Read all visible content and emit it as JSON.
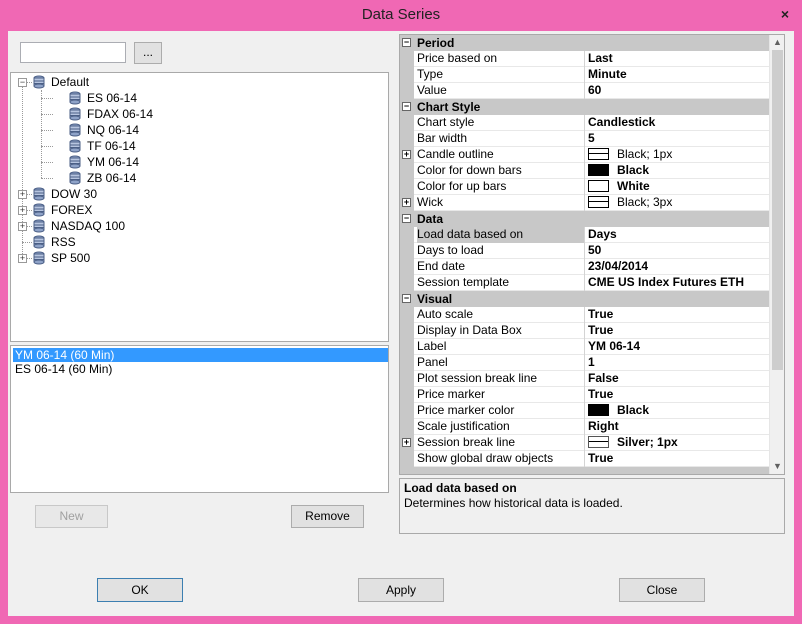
{
  "window": {
    "title": "Data Series",
    "close_glyph": "×"
  },
  "search": {
    "value": "",
    "browse_label": "..."
  },
  "tree": {
    "items": [
      {
        "label": "Default",
        "expanded": true,
        "level": 0
      },
      {
        "label": "ES 06-14",
        "level": 1
      },
      {
        "label": "FDAX 06-14",
        "level": 1
      },
      {
        "label": "NQ 06-14",
        "level": 1
      },
      {
        "label": "TF 06-14",
        "level": 1
      },
      {
        "label": "YM 06-14",
        "level": 1
      },
      {
        "label": "ZB 06-14",
        "level": 1
      },
      {
        "label": "DOW 30",
        "expanded": false,
        "level": 0
      },
      {
        "label": "FOREX",
        "expanded": false,
        "level": 0
      },
      {
        "label": "NASDAQ 100",
        "expanded": false,
        "level": 0
      },
      {
        "label": "RSS",
        "level": 0
      },
      {
        "label": "SP 500",
        "expanded": false,
        "level": 0
      }
    ]
  },
  "series_list": {
    "items": [
      {
        "label": "YM 06-14 (60 Min)",
        "selected": true
      },
      {
        "label": "ES 06-14 (60 Min)",
        "selected": false
      }
    ]
  },
  "buttons": {
    "new": "New",
    "remove": "Remove",
    "ok": "OK",
    "apply": "Apply",
    "close": "Close"
  },
  "grid": {
    "categories": [
      {
        "label": "Period",
        "props": [
          {
            "name": "Price based on",
            "value": "Last"
          },
          {
            "name": "Type",
            "value": "Minute"
          },
          {
            "name": "Value",
            "value": "60"
          }
        ]
      },
      {
        "label": "Chart Style",
        "props": [
          {
            "name": "Chart style",
            "value": "Candlestick"
          },
          {
            "name": "Bar width",
            "value": "5"
          },
          {
            "name": "Candle outline",
            "value": "Black; 1px",
            "swatch": "line",
            "light": true,
            "expandable": true
          },
          {
            "name": "Color for down bars",
            "value": "Black",
            "swatch": "#000000"
          },
          {
            "name": "Color for up bars",
            "value": "White",
            "swatch": "#ffffff"
          },
          {
            "name": "Wick",
            "value": "Black; 3px",
            "swatch": "line",
            "light": true,
            "expandable": true
          }
        ]
      },
      {
        "label": "Data",
        "props": [
          {
            "name": "Load data based on",
            "value": "Days",
            "highlight": true
          },
          {
            "name": "Days to load",
            "value": "50"
          },
          {
            "name": "End date",
            "value": "23/04/2014"
          },
          {
            "name": "Session template",
            "value": "CME US Index Futures ETH"
          }
        ]
      },
      {
        "label": "Visual",
        "props": [
          {
            "name": "Auto scale",
            "value": "True"
          },
          {
            "name": "Display in Data Box",
            "value": "True"
          },
          {
            "name": "Label",
            "value": "YM 06-14"
          },
          {
            "name": "Panel",
            "value": "1"
          },
          {
            "name": "Plot session break line",
            "value": "False"
          },
          {
            "name": "Price marker",
            "value": "True"
          },
          {
            "name": "Price marker color",
            "value": "Black",
            "swatch": "#000000"
          },
          {
            "name": "Scale justification",
            "value": "Right"
          },
          {
            "name": "Session break line",
            "value": "Silver; 1px",
            "swatch": "line-silver",
            "expandable": true
          },
          {
            "name": "Show global draw objects",
            "value": "True"
          }
        ]
      }
    ]
  },
  "description": {
    "title": "Load data based on",
    "text": "Determines how historical data is loaded."
  },
  "colors": {
    "frame": "#f068b4",
    "selection": "#3399ff",
    "category": "#c8c8c8"
  }
}
